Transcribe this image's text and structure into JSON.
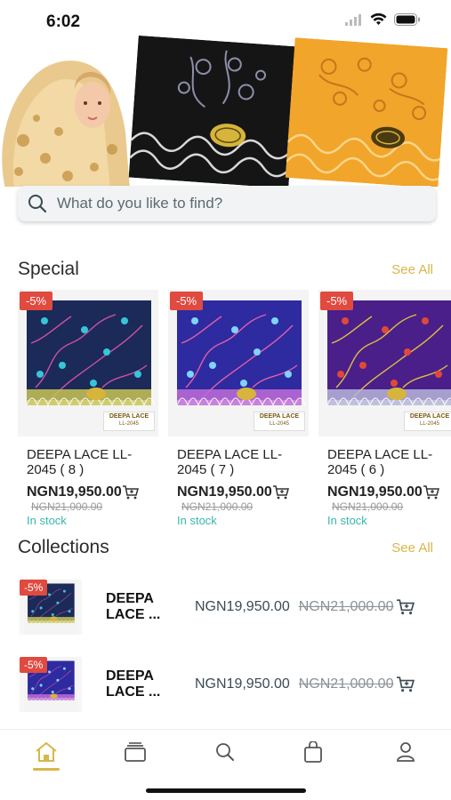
{
  "status_bar": {
    "time": "6:02"
  },
  "search": {
    "placeholder": "What do you like to find?"
  },
  "special": {
    "title": "Special",
    "see_all": "See All",
    "items": [
      {
        "discount": "-5%",
        "name": "DEEPA LACE LL-2045 ( 8 )",
        "price": "NGN19,950.00",
        "old_price": "NGN21,000.00",
        "stock": "In stock",
        "label": "DEEPA LACE",
        "code": "LL-2045"
      },
      {
        "discount": "-5%",
        "name": "DEEPA LACE LL-2045 ( 7 )",
        "price": "NGN19,950.00",
        "old_price": "NGN21,000.00",
        "stock": "In stock",
        "label": "DEEPA LACE",
        "code": "LL-2045"
      },
      {
        "discount": "-5%",
        "name": "DEEPA LACE LL-2045 ( 6 )",
        "price": "NGN19,950.00",
        "old_price": "NGN21,000.00",
        "stock": "In stock",
        "label": "DEEPA LACE",
        "code": "LL-2045"
      }
    ]
  },
  "collections": {
    "title": "Collections",
    "see_all": "See All",
    "items": [
      {
        "discount": "-5%",
        "name": "DEEPA LACE ...",
        "price": "NGN19,950.00",
        "old_price": "NGN21,000.00"
      },
      {
        "discount": "-5%",
        "name": "DEEPA LACE ...",
        "price": "NGN19,950.00",
        "old_price": "NGN21,000.00"
      }
    ]
  },
  "nav": {
    "items": [
      "home-icon",
      "collections-icon",
      "search-icon",
      "bag-icon",
      "profile-icon"
    ],
    "active": "home-icon"
  },
  "colors": {
    "accent": "#d8b64a",
    "badge": "#e04a3f",
    "stock": "#38b6ad"
  }
}
